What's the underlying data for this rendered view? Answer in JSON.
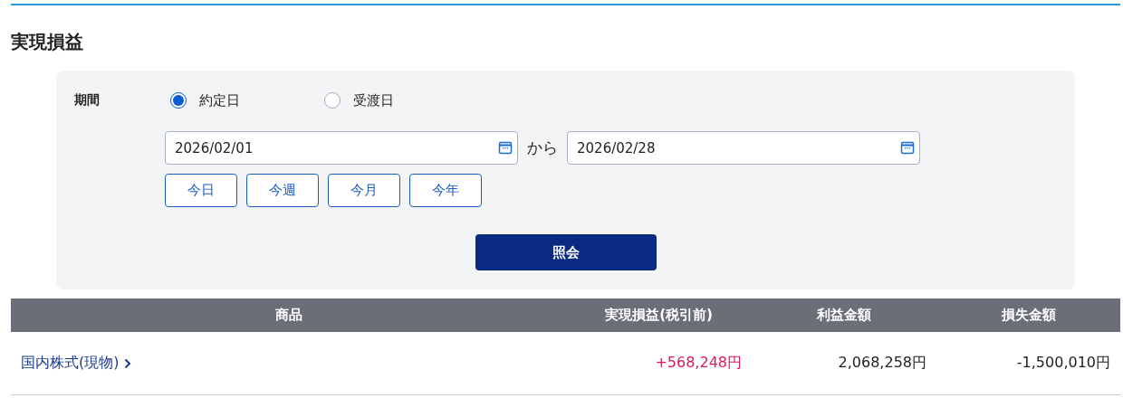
{
  "title": "実現損益",
  "filter": {
    "label": "期間",
    "date_basis": [
      {
        "label": "約定日",
        "selected": true
      },
      {
        "label": "受渡日",
        "selected": false
      }
    ],
    "date_from": {
      "value": "2026/02/01"
    },
    "separator": "から",
    "date_to": {
      "value": "2026/02/28"
    },
    "quick_ranges": [
      "今日",
      "今週",
      "今月",
      "今年"
    ],
    "submit": "照会"
  },
  "table": {
    "columns": [
      "商品",
      "実現損益(税引前)",
      "利益金額",
      "損失金額"
    ],
    "rows": [
      [
        {
          "kind": "link",
          "text": "国内株式(現物)"
        },
        {
          "kind": "gain",
          "text": "+568,248円"
        },
        {
          "kind": "plain",
          "text": "2,068,258円"
        },
        {
          "kind": "plain",
          "text": "-1,500,010円"
        }
      ]
    ]
  }
}
